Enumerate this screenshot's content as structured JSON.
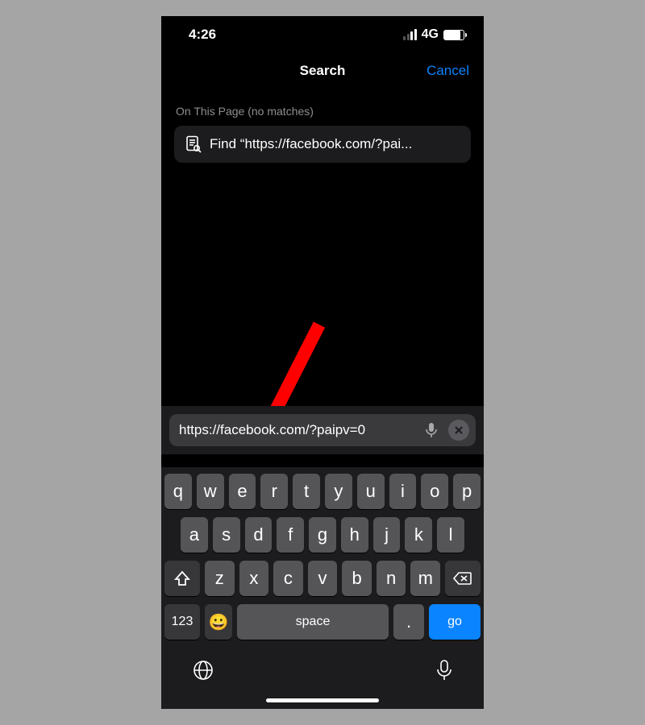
{
  "status": {
    "time": "4:26",
    "network": "4G"
  },
  "nav": {
    "title": "Search",
    "cancel": "Cancel"
  },
  "section": {
    "header": "On This Page (no matches)",
    "find_prefix": "Find “https://facebook.com/?pai..."
  },
  "urlbar": {
    "text": "https://facebook.com/?paipv=0"
  },
  "keyboard": {
    "row1": [
      "q",
      "w",
      "e",
      "r",
      "t",
      "y",
      "u",
      "i",
      "o",
      "p"
    ],
    "row2": [
      "a",
      "s",
      "d",
      "f",
      "g",
      "h",
      "j",
      "k",
      "l"
    ],
    "row3": [
      "z",
      "x",
      "c",
      "v",
      "b",
      "n",
      "m"
    ],
    "numeric": "123",
    "space": "space",
    "dot": ".",
    "go": "go"
  }
}
